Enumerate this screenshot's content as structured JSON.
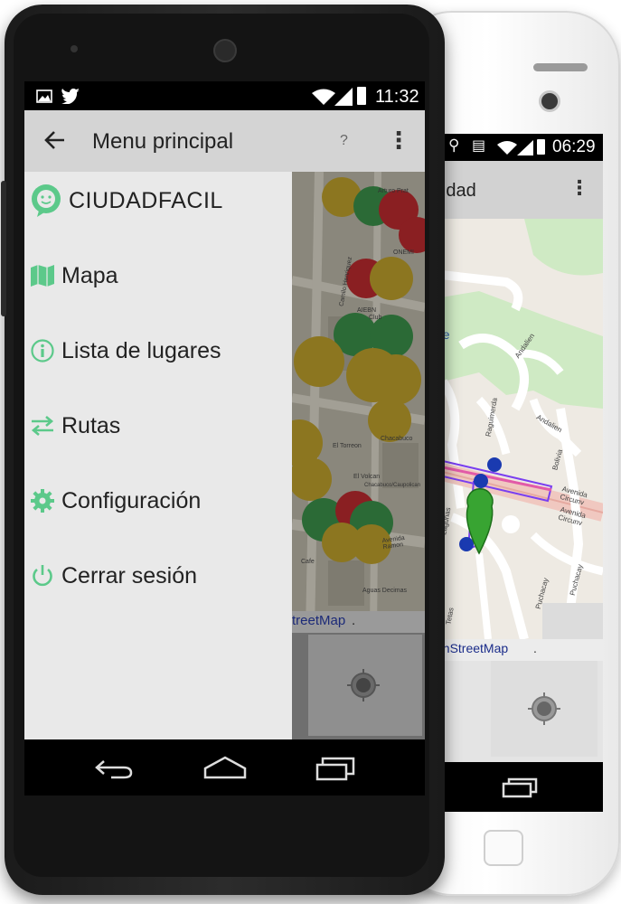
{
  "front_phone": {
    "status_bar": {
      "time": "11:32"
    },
    "toolbar": {
      "title": "Menu principal",
      "help_label": "?"
    },
    "drawer": {
      "brand": "CIUDADFACIL",
      "items": [
        {
          "label": "Mapa",
          "icon": "map-icon"
        },
        {
          "label": "Lista de lugares",
          "icon": "info-icon"
        },
        {
          "label": "Rutas",
          "icon": "swap-arrows-icon"
        },
        {
          "label": "Configuración",
          "icon": "gear-icon"
        },
        {
          "label": "Cerrar sesión",
          "icon": "power-icon"
        }
      ]
    },
    "map": {
      "attribution": "treetMap",
      "labels": [
        "Arturo Prat",
        "ONEMI",
        "Camilo Henriquez",
        "AIEBN",
        "Club",
        "El Torreon",
        "Chacabuco",
        "El Volcan",
        "Chacabuco/Caupolican",
        "Avenida Ramon",
        "Cafe",
        "Aguas Decimas"
      ]
    }
  },
  "back_phone": {
    "status_bar": {
      "time": "06:29"
    },
    "toolbar": {
      "title": "ilidad"
    },
    "map": {
      "attribution": "enStreetMap",
      "labels": [
        "Andalien",
        "Andalien",
        "Raguimerda",
        "Bolivia",
        "Avenida Circunv",
        "Avenida Circunv",
        "Lagunas",
        "Puchacay",
        "Puchacay",
        "Tetas",
        "ue"
      ]
    }
  },
  "colors": {
    "accent_green": "#5cc98a",
    "marker_yellow": "#c9a52a",
    "marker_green": "#3d9a4e",
    "marker_red": "#c02a30",
    "route_purple": "#7a3ff0"
  }
}
